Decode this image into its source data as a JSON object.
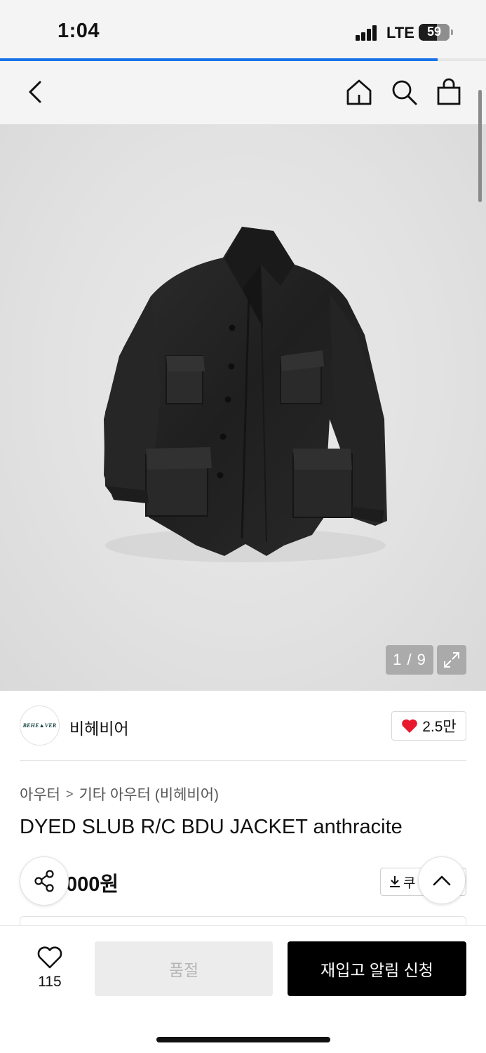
{
  "status_bar": {
    "time": "1:04",
    "network": "LTE",
    "battery": "59",
    "battery_level": 0.59
  },
  "page_load_progress": 0.9,
  "nav": {
    "icons": [
      "back-chevron-icon",
      "home-icon",
      "search-icon",
      "shopping-bag-icon"
    ]
  },
  "gallery": {
    "counter": "1 / 9",
    "current": 1,
    "total": 9
  },
  "brand": {
    "logo_text": "BEHEAVER",
    "name": "비헤비어",
    "likes": "2.5만"
  },
  "breadcrumb": {
    "category": "아우터",
    "separator": ">",
    "subcategory": "기타 아우터 (비헤비어)"
  },
  "product": {
    "title": "DYED SLUB R/C BDU JACKET anthracite",
    "price_visible": "000원",
    "coupon_label": "쿠"
  },
  "bottom_bar": {
    "wish_count": "115",
    "soldout_label": "품절",
    "restock_label": "재입고 알림 신청"
  },
  "colors": {
    "accent_blue": "#1a73e8",
    "heart_red": "#e8192c",
    "primary_black": "#000000",
    "disabled_gray": "#ececec"
  }
}
